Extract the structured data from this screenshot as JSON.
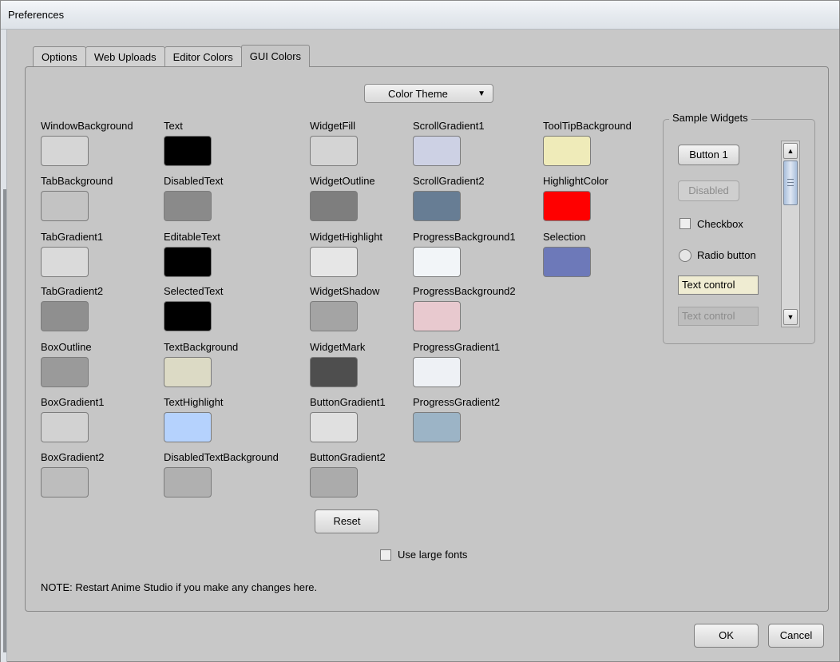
{
  "window": {
    "title": "Preferences"
  },
  "tabs": [
    {
      "label": "Options",
      "active": false
    },
    {
      "label": "Web Uploads",
      "active": false
    },
    {
      "label": "Editor Colors",
      "active": false
    },
    {
      "label": "GUI Colors",
      "active": true
    }
  ],
  "theme_dropdown": {
    "label": "Color Theme",
    "arrow": "▼"
  },
  "colors": [
    {
      "label": "WindowBackground",
      "color": "#d6d6d6"
    },
    {
      "label": "TabBackground",
      "color": "#c3c3c3"
    },
    {
      "label": "TabGradient1",
      "color": "#dadada"
    },
    {
      "label": "TabGradient2",
      "color": "#8f8f8f"
    },
    {
      "label": "BoxOutline",
      "color": "#9a9a9a"
    },
    {
      "label": "BoxGradient1",
      "color": "#d2d2d2"
    },
    {
      "label": "BoxGradient2",
      "color": "#bdbdbd"
    },
    {
      "label": "Text",
      "color": "#000000"
    },
    {
      "label": "DisabledText",
      "color": "#8a8a8a"
    },
    {
      "label": "EditableText",
      "color": "#000000"
    },
    {
      "label": "SelectedText",
      "color": "#000000"
    },
    {
      "label": "TextBackground",
      "color": "#dcdac5"
    },
    {
      "label": "TextHighlight",
      "color": "#b5d2fd"
    },
    {
      "label": "DisabledTextBackground",
      "color": "#b0b0b0"
    },
    {
      "label": "WidgetFill",
      "color": "#d4d4d4"
    },
    {
      "label": "WidgetOutline",
      "color": "#7e7e7e"
    },
    {
      "label": "WidgetHighlight",
      "color": "#e6e6e6"
    },
    {
      "label": "WidgetShadow",
      "color": "#a4a4a4"
    },
    {
      "label": "WidgetMark",
      "color": "#4e4e4e"
    },
    {
      "label": "ButtonGradient1",
      "color": "#e0e0e0"
    },
    {
      "label": "ButtonGradient2",
      "color": "#ababab"
    },
    {
      "label": "ScrollGradient1",
      "color": "#cdd1e4"
    },
    {
      "label": "ScrollGradient2",
      "color": "#677d94"
    },
    {
      "label": "ProgressBackground1",
      "color": "#f2f5f8"
    },
    {
      "label": "ProgressBackground2",
      "color": "#e8c9cf"
    },
    {
      "label": "ProgressGradient1",
      "color": "#eef1f5"
    },
    {
      "label": "ProgressGradient2",
      "color": "#9cb4c6"
    },
    {
      "label": "ToolTipBackground",
      "color": "#efebb9"
    },
    {
      "label": "HighlightColor",
      "color": "#ff0000"
    },
    {
      "label": "Selection",
      "color": "#6d79b9"
    }
  ],
  "reset_button": "Reset",
  "large_fonts": {
    "label": "Use large fonts",
    "checked": false
  },
  "note": "NOTE: Restart Anime Studio if you make any changes here.",
  "sample_widgets": {
    "title": "Sample Widgets",
    "button1": "Button 1",
    "disabled_button": "Disabled",
    "checkbox": "Checkbox",
    "radio": "Radio button",
    "text_control": "Text control",
    "text_control_disabled": "Text control",
    "scroll_up": "▲",
    "scroll_down": "▼"
  },
  "ok_button": "OK",
  "cancel_button": "Cancel"
}
